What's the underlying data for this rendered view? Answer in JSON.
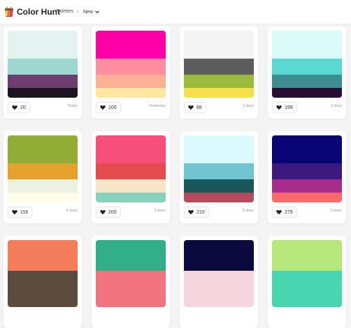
{
  "header": {
    "brand": "Color Hunt",
    "breadcrumb": [
      "Palettes",
      "New"
    ],
    "separator": "›"
  },
  "colors": {
    "accent": "#222222",
    "background": "#f4f4f5"
  },
  "icons": {
    "logo": "palette-logo-icon",
    "like": "heart-icon",
    "dropdown": "chevron-down-icon"
  },
  "cards": [
    {
      "colors": [
        "#e3f1ef",
        "#9dd8d0",
        "#6c3e70",
        "#1c1420"
      ],
      "likes": "20",
      "date": "Today"
    },
    {
      "colors": [
        "#ff00a6",
        "#ff8fa0",
        "#ffb195",
        "#ffe7a1"
      ],
      "likes": "100",
      "date": "Yesterday"
    },
    {
      "colors": [
        "#f4f4f5",
        "#5c5c5c",
        "#99ba3a",
        "#f3e04a"
      ],
      "likes": "88",
      "date": "3 days"
    },
    {
      "colors": [
        "#dbfafa",
        "#5ad8d2",
        "#3d8e91",
        "#2a0b34"
      ],
      "likes": "199",
      "date": "3 days"
    },
    {
      "colors": [
        "#92ad36",
        "#e4a22c",
        "#ecf2df",
        "#fdfde8"
      ],
      "likes": "116",
      "date": "4 days"
    },
    {
      "colors": [
        "#f54f7a",
        "#e54c50",
        "#f6e5c6",
        "#86d1bc"
      ],
      "likes": "200",
      "date": "5 days"
    },
    {
      "colors": [
        "#dafbfd",
        "#6fc5d0",
        "#17575a",
        "#b64a5d"
      ],
      "likes": "210",
      "date": "6 days"
    },
    {
      "colors": [
        "#070473",
        "#3b197f",
        "#a62e8a",
        "#fb6a6a"
      ],
      "likes": "279",
      "date": "1 week"
    },
    {
      "colors": [
        "#f47d5a",
        "#5b4a3e"
      ],
      "likes": "",
      "date": ""
    },
    {
      "colors": [
        "#2fae88",
        "#f27481"
      ],
      "likes": "",
      "date": ""
    },
    {
      "colors": [
        "#080b3c",
        "#f5d6de"
      ],
      "likes": "",
      "date": ""
    },
    {
      "colors": [
        "#b5e779",
        "#49d5b0"
      ],
      "likes": "",
      "date": ""
    }
  ]
}
